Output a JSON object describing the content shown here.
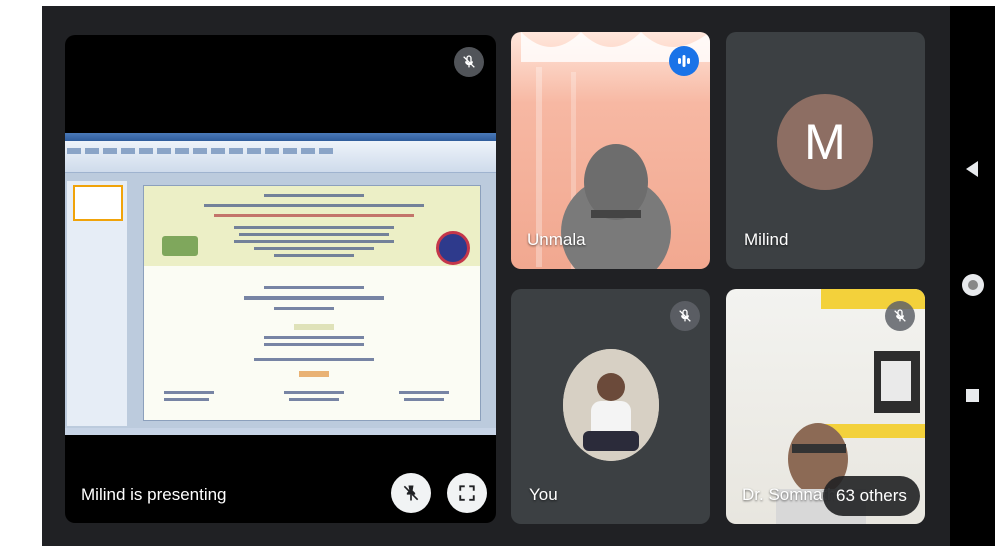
{
  "presentation": {
    "presenter_label": "Milind is presenting"
  },
  "participants": [
    {
      "name": "Unmala"
    },
    {
      "name": "Milind",
      "avatar_letter": "M",
      "avatar_color": "#8d6e63"
    },
    {
      "name": "You"
    },
    {
      "name": "Dr. Somnath"
    }
  ],
  "others": {
    "label": "63 others"
  },
  "icons": {
    "mic_off": "mic-off-icon",
    "speaking": "speaking-indicator-icon",
    "pin": "pin-off-icon",
    "fullscreen": "fullscreen-icon",
    "back": "back-icon",
    "home": "home-icon",
    "recents": "recents-icon"
  },
  "colors": {
    "background": "#202124",
    "tile": "#3c4043",
    "speaking_blue": "#1a73e8",
    "avatar_brown": "#8d6e63"
  }
}
